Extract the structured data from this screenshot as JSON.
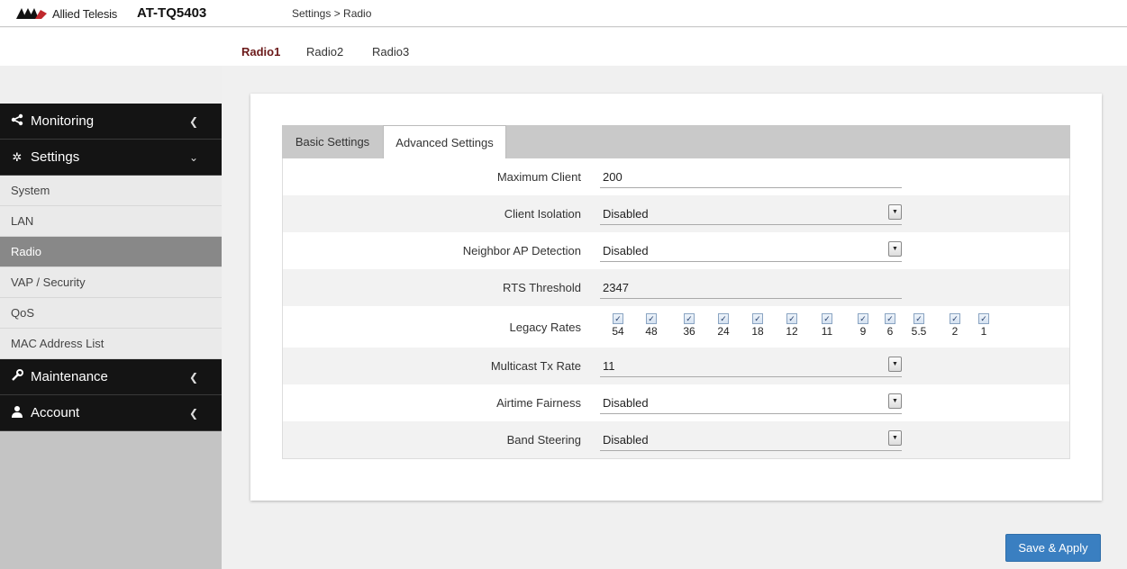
{
  "header": {
    "brand": "Allied Telesis",
    "model": "AT-TQ5403",
    "breadcrumb": "Settings > Radio"
  },
  "radio_tabs": [
    "Radio1",
    "Radio2",
    "Radio3"
  ],
  "sidebar": {
    "monitoring": "Monitoring",
    "settings": "Settings",
    "settings_items": [
      "System",
      "LAN",
      "Radio",
      "VAP / Security",
      "QoS",
      "MAC Address List"
    ],
    "maintenance": "Maintenance",
    "account": "Account"
  },
  "panel_tabs": {
    "basic": "Basic Settings",
    "advanced": "Advanced Settings"
  },
  "form": {
    "max_client": {
      "label": "Maximum Client",
      "value": "200"
    },
    "client_isolation": {
      "label": "Client Isolation",
      "value": "Disabled"
    },
    "neighbor_ap": {
      "label": "Neighbor AP Detection",
      "value": "Disabled"
    },
    "rts": {
      "label": "RTS Threshold",
      "value": "2347"
    },
    "legacy_rates": {
      "label": "Legacy Rates",
      "rates": [
        "54",
        "48",
        "36",
        "24",
        "18",
        "12",
        "11",
        "9",
        "6",
        "5.5",
        "2",
        "1"
      ],
      "check": "✓"
    },
    "multicast": {
      "label": "Multicast Tx Rate",
      "value": "11"
    },
    "airtime": {
      "label": "Airtime Fairness",
      "value": "Disabled"
    },
    "band_steering": {
      "label": "Band Steering",
      "value": "Disabled"
    }
  },
  "save_label": "Save & Apply",
  "colors": {
    "accent": "#3a7fc1",
    "active_radio": "#6b1a1a",
    "sidebar_dark": "#141414"
  }
}
